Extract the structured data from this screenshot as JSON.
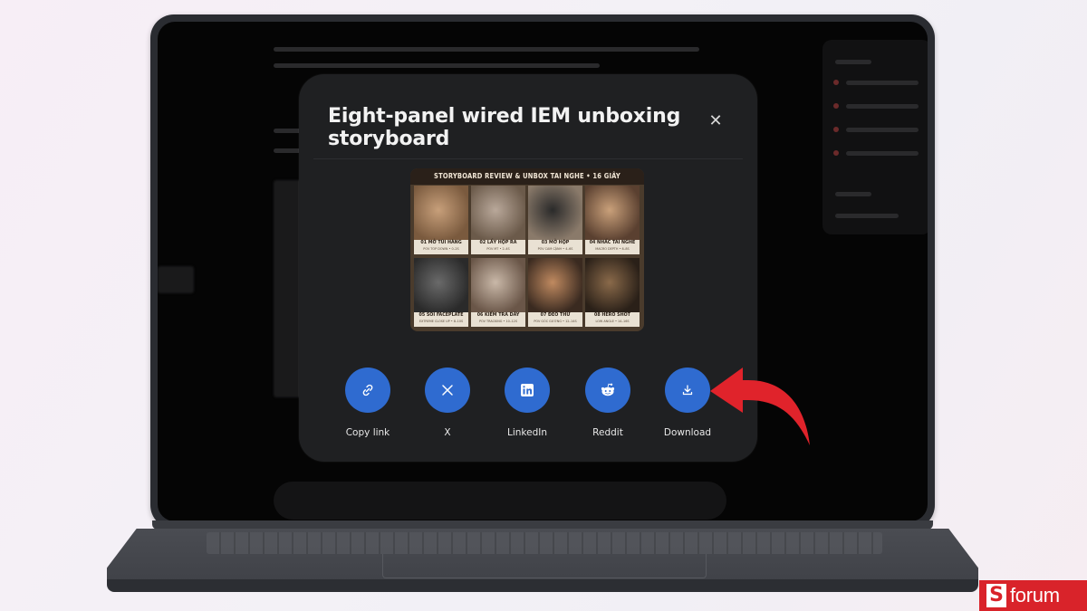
{
  "modal": {
    "title": "Eight-panel wired IEM unboxing storyboard",
    "close_symbol": "✕"
  },
  "storyboard": {
    "header": "STORYBOARD REVIEW & UNBOX TAI NGHE • 16 GIÂY",
    "panels": [
      {
        "title": "01  MỞ TÚI HÀNG",
        "sub": "POV TOP DOWN • 0–2S",
        "colors": [
          "#c79f7a",
          "#7a5a3e"
        ]
      },
      {
        "title": "02  LẤY HỘP RA",
        "sub": "POV MT • 2–4S",
        "colors": [
          "#b9a89a",
          "#6b5a4a"
        ]
      },
      {
        "title": "03  MỞ HỘP",
        "sub": "POV CAM CẬNH • 4–6S",
        "colors": [
          "#2a2a2a",
          "#8a7a6a"
        ]
      },
      {
        "title": "04  NHẤC TAI NGHE",
        "sub": "MACRO DEPTH • 6–8S",
        "colors": [
          "#c9a07a",
          "#5a4030"
        ]
      },
      {
        "title": "05  SOI FACEPLATE",
        "sub": "EXTREME CLOSE UP • 8–10S",
        "colors": [
          "#6a6a6a",
          "#2a2a2a"
        ]
      },
      {
        "title": "06  KIỂM TRA DÂY",
        "sub": "POV TRACKING • 10–12S",
        "colors": [
          "#c9b8a8",
          "#6a5648"
        ]
      },
      {
        "title": "07  ĐEO THỬ",
        "sub": "POV GÓC GƯƠNG • 12–14S",
        "colors": [
          "#c08a60",
          "#3a2a20"
        ]
      },
      {
        "title": "08  HERO SHOT",
        "sub": "LOW ANGLE • 14–16S",
        "colors": [
          "#8a6a4a",
          "#2a2018"
        ]
      }
    ]
  },
  "share": [
    {
      "label": "Copy link",
      "icon": "link-icon"
    },
    {
      "label": "X",
      "icon": "x-logo-icon"
    },
    {
      "label": "LinkedIn",
      "icon": "linkedin-icon"
    },
    {
      "label": "Reddit",
      "icon": "reddit-icon"
    },
    {
      "label": "Download",
      "icon": "download-icon"
    }
  ],
  "watermark": {
    "brand_letter": "S",
    "brand_text": "forum",
    "color": "#d9232a"
  },
  "accent": "#2f6bd0",
  "arrow_color": "#e0232b"
}
